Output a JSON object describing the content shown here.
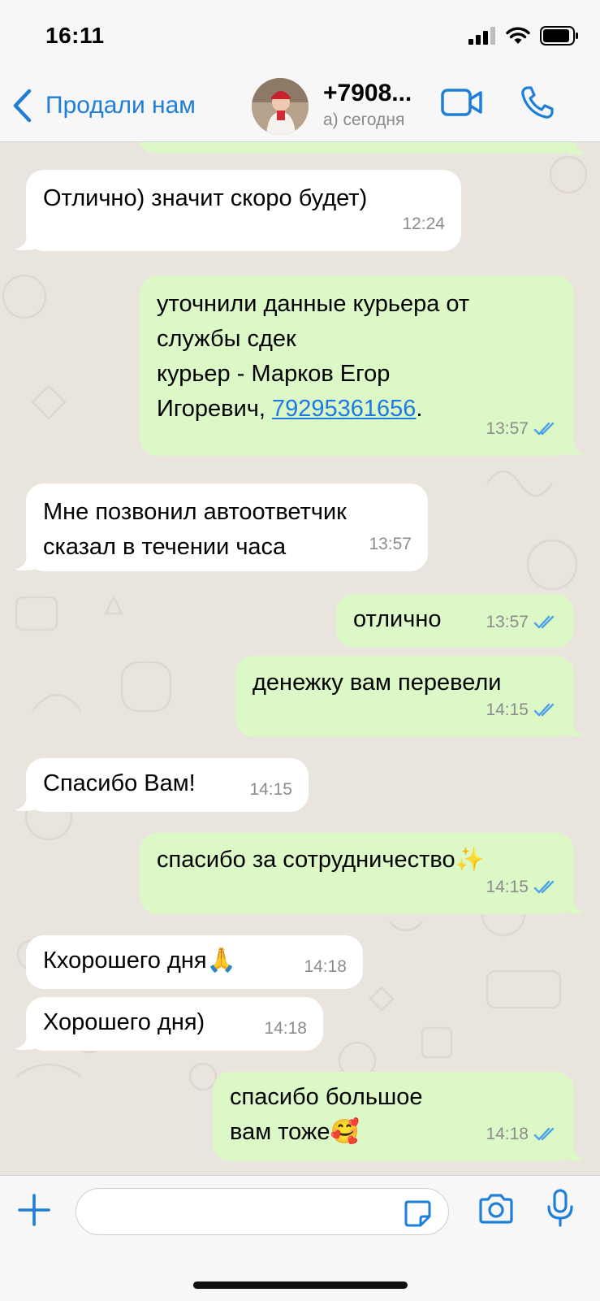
{
  "status_bar": {
    "time": "16:11"
  },
  "header": {
    "back_label": "Продали нам",
    "contact_name": "+7908...",
    "contact_status": "а) сегодня"
  },
  "messages": [
    {
      "direction": "in",
      "text": "Отлично) значит скоро будет)",
      "time": "12:24"
    },
    {
      "direction": "out",
      "text": "уточнили данные курьера от\nслужбы сдек\nкурьер - Марков Егор\nИгоревич, ",
      "link": "79295361656",
      "after_link": ".",
      "time": "13:57",
      "read": true
    },
    {
      "direction": "in",
      "text": "Мне позвонил автоответчик\nсказал в течении часа",
      "time": "13:57"
    },
    {
      "direction": "out",
      "text": "отлично",
      "time": "13:57",
      "read": true
    },
    {
      "direction": "out",
      "text": "денежку вам перевели",
      "time": "14:15",
      "read": true
    },
    {
      "direction": "in",
      "text": "Спасибо Вам!",
      "time": "14:15"
    },
    {
      "direction": "out",
      "text": "спасибо за сотрудничество✨",
      "time": "14:15",
      "read": true
    },
    {
      "direction": "in",
      "text": "Кхорошего дня🙏",
      "time": "14:18"
    },
    {
      "direction": "in",
      "text": "Хорошего дня)",
      "time": "14:18"
    },
    {
      "direction": "out",
      "text": "спасибо большое\nвам тоже🥰",
      "time": "14:18",
      "read": true
    }
  ],
  "colors": {
    "accent": "#1f7ed8",
    "outgoing_bubble": "#dcf8c6",
    "incoming_bubble": "#ffffff",
    "chat_background": "#e9e4dd",
    "read_ticks": "#4fa3e8"
  },
  "icons": {
    "back": "chevron-left-icon",
    "video": "video-camera-icon",
    "call": "phone-icon",
    "plus": "plus-icon",
    "sticker": "sticker-icon",
    "camera": "camera-icon",
    "mic": "microphone-icon"
  }
}
